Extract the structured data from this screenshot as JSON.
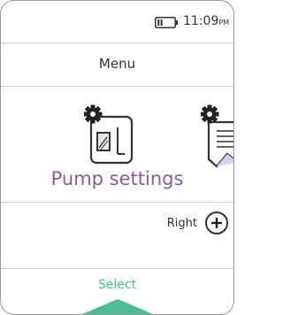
{
  "status_bar": {
    "time": "11:09",
    "ampm": "PM",
    "battery_icon": "battery-icon"
  },
  "header": {
    "title": "Menu"
  },
  "carousel": {
    "current": {
      "label": "Pump settings",
      "icon": "pump-settings-icon"
    },
    "next": {
      "icon": "settings-document-icon"
    }
  },
  "navigation": {
    "right_label": "Right",
    "right_icon": "plus-circle-icon"
  },
  "action": {
    "select_label": "Select",
    "accent_color": "#4bbf93"
  },
  "colors": {
    "label_purple": "#8a5aa8",
    "select_green": "#4bbf93",
    "divider": "#cfcfcf"
  }
}
